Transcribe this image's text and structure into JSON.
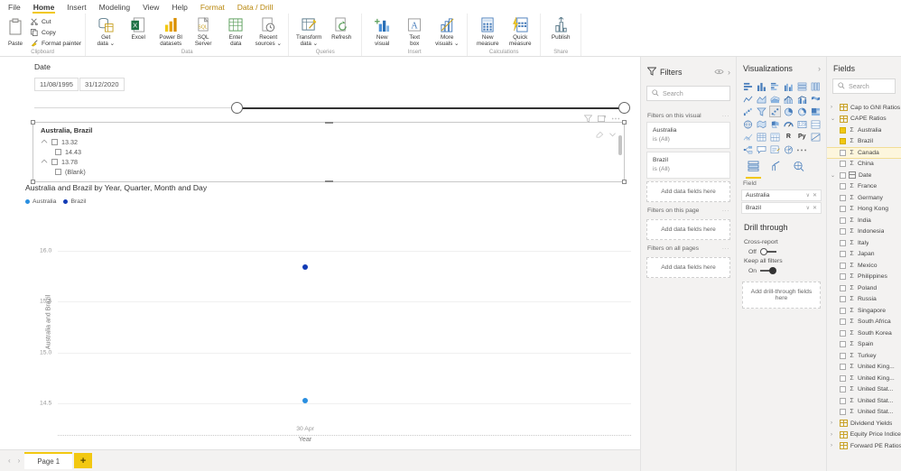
{
  "ribbon": {
    "tabs": [
      {
        "label": "File",
        "state": "normal"
      },
      {
        "label": "Home",
        "state": "active"
      },
      {
        "label": "Insert",
        "state": "normal"
      },
      {
        "label": "Modeling",
        "state": "normal"
      },
      {
        "label": "View",
        "state": "normal"
      },
      {
        "label": "Help",
        "state": "normal"
      },
      {
        "label": "Format",
        "state": "contextual"
      },
      {
        "label": "Data / Drill",
        "state": "contextual"
      }
    ],
    "groups": [
      {
        "name": "Clipboard",
        "paste": "Paste",
        "small": [
          {
            "label": "Cut",
            "icon": "scissors-icon"
          },
          {
            "label": "Copy",
            "icon": "copy-icon"
          },
          {
            "label": "Format painter",
            "icon": "paintbrush-icon"
          }
        ]
      },
      {
        "name": "Data",
        "buttons": [
          {
            "label": "Get\ndata ⌄",
            "icon": "get-data-icon"
          },
          {
            "label": "Excel",
            "icon": "excel-icon"
          },
          {
            "label": "Power BI\ndatasets",
            "icon": "powerbi-datasets-icon"
          },
          {
            "label": "SQL\nServer",
            "icon": "sql-server-icon"
          },
          {
            "label": "Enter\ndata",
            "icon": "enter-data-icon"
          },
          {
            "label": "Recent\nsources ⌄",
            "icon": "recent-sources-icon"
          }
        ]
      },
      {
        "name": "Queries",
        "buttons": [
          {
            "label": "Transform\ndata ⌄",
            "icon": "transform-data-icon"
          },
          {
            "label": "Refresh",
            "icon": "refresh-icon"
          }
        ]
      },
      {
        "name": "Insert",
        "buttons": [
          {
            "label": "New\nvisual",
            "icon": "new-visual-icon"
          },
          {
            "label": "Text\nbox",
            "icon": "text-box-icon"
          },
          {
            "label": "More\nvisuals ⌄",
            "icon": "more-visuals-icon"
          }
        ]
      },
      {
        "name": "Calculations",
        "buttons": [
          {
            "label": "New\nmeasure",
            "icon": "new-measure-icon"
          },
          {
            "label": "Quick\nmeasure",
            "icon": "quick-measure-icon"
          }
        ]
      },
      {
        "name": "Share",
        "buttons": [
          {
            "label": "Publish",
            "icon": "publish-icon"
          }
        ]
      }
    ]
  },
  "canvas": {
    "date_slicer": {
      "title": "Date",
      "start_value": "11/08/1995",
      "end_value": "31/12/2020",
      "handle_left_pct": 34,
      "handle_right_pct": 99
    },
    "hierarchy_slicer": {
      "title": "Australia, Brazil",
      "rows": [
        {
          "label": "13.32",
          "level": 0,
          "expanded": true,
          "checked": false
        },
        {
          "label": "14.43",
          "level": 1,
          "expanded": false,
          "checked": false
        },
        {
          "label": "13.78",
          "level": 0,
          "expanded": true,
          "checked": false
        },
        {
          "label": "(Blank)",
          "level": 1,
          "expanded": false,
          "checked": false
        }
      ],
      "header_icons": [
        "filter-icon",
        "focus-mode-icon",
        "more-options-icon"
      ],
      "inner_icons": [
        "clear-selections-icon",
        "chevron-down-icon"
      ]
    }
  },
  "chart_data": {
    "type": "scatter",
    "title": "Australia and Brazil by Year, Quarter, Month and Day",
    "xlabel": "Year",
    "ylabel": "Australia and Brazil",
    "yticks": [
      "16.0",
      "15.5",
      "15.0",
      "14.5"
    ],
    "ylim": [
      14.3,
      16.2
    ],
    "xticks": [
      "30 Apr"
    ],
    "grid": true,
    "legend_position": "top-left",
    "series": [
      {
        "name": "Australia",
        "color": "#2a8fe0",
        "points": [
          {
            "x": "30 Apr",
            "y": 14.53
          }
        ]
      },
      {
        "name": "Brazil",
        "color": "#123bb5",
        "points": [
          {
            "x": "30 Apr",
            "y": 15.84
          }
        ]
      }
    ]
  },
  "page_bar": {
    "prev_label": "‹",
    "next_label": "›",
    "tabs": [
      "Page 1"
    ],
    "add_label": "+"
  },
  "filters_pane": {
    "title": "Filters",
    "icons": [
      "filter-icon",
      "hide-pane-icon",
      "collapse-pane-icon"
    ],
    "search_placeholder": "Search",
    "sections": [
      {
        "label": "Filters on this visual",
        "cards": [
          {
            "name": "Australia",
            "state": "is (All)"
          },
          {
            "name": "Brazil",
            "state": "is (All)"
          }
        ],
        "dropzone": "Add data fields here"
      },
      {
        "label": "Filters on this page",
        "cards": [],
        "dropzone": "Add data fields here"
      },
      {
        "label": "Filters on all pages",
        "cards": [],
        "dropzone": "Add data fields here"
      }
    ]
  },
  "visualizations_pane": {
    "title": "Visualizations",
    "collapse_icon": "chevron-right-icon",
    "icons": [
      "stacked-bar-chart-icon",
      "stacked-column-chart-icon",
      "clustered-bar-chart-icon",
      "clustered-column-chart-icon",
      "100-stacked-bar-icon",
      "100-stacked-column-icon",
      "line-chart-icon",
      "area-chart-icon",
      "stacked-area-chart-icon",
      "line-stacked-column-icon",
      "line-clustered-column-icon",
      "ribbon-chart-icon",
      "waterfall-chart-icon",
      "funnel-icon",
      "scatter-chart-icon",
      "pie-chart-icon",
      "donut-chart-icon",
      "treemap-icon",
      "map-icon",
      "filled-map-icon",
      "shape-map-icon",
      "gauge-icon",
      "card-icon",
      "multi-row-card-icon",
      "kpi-icon",
      "table-icon",
      "matrix-icon",
      "r-script-visual-icon",
      "python-visual-icon",
      "key-influencers-icon",
      "decomposition-tree-icon",
      "q-and-a-icon",
      "smart-narrative-icon",
      "paginated-report-icon",
      "more-visuals-ellipsis-icon"
    ],
    "tabs": [
      "fields-tab-icon",
      "format-tab-icon",
      "analytics-tab-icon"
    ],
    "field_section_label": "Field",
    "field_wells": [
      "Australia",
      "Brazil"
    ],
    "drill_through": {
      "title": "Drill through",
      "cross_report_label": "Cross-report",
      "cross_report_state": "Off",
      "keep_filters_label": "Keep all filters",
      "keep_filters_state": "On",
      "dropzone": "Add drill-through fields here"
    }
  },
  "fields_pane": {
    "title": "Fields",
    "search_placeholder": "Search",
    "items": [
      {
        "label": "Cap to GNI Ratios",
        "type": "table",
        "expanded": false,
        "indent": 0
      },
      {
        "label": "CAPE Ratios",
        "type": "table",
        "expanded": true,
        "indent": 0,
        "selected": true
      },
      {
        "label": "Australia",
        "type": "measure",
        "checked": true,
        "indent": 1
      },
      {
        "label": "Brazil",
        "type": "measure",
        "checked": true,
        "indent": 1
      },
      {
        "label": "Canada",
        "type": "measure",
        "checked": false,
        "indent": 1,
        "highlight": true
      },
      {
        "label": "China",
        "type": "measure",
        "checked": false,
        "indent": 1
      },
      {
        "label": "Date",
        "type": "date-hierarchy",
        "checked": false,
        "indent": 1,
        "expanded": true
      },
      {
        "label": "France",
        "type": "measure",
        "checked": false,
        "indent": 1
      },
      {
        "label": "Germany",
        "type": "measure",
        "checked": false,
        "indent": 1
      },
      {
        "label": "Hong Kong",
        "type": "measure",
        "checked": false,
        "indent": 1
      },
      {
        "label": "India",
        "type": "measure",
        "checked": false,
        "indent": 1
      },
      {
        "label": "Indonesia",
        "type": "measure",
        "checked": false,
        "indent": 1
      },
      {
        "label": "Italy",
        "type": "measure",
        "checked": false,
        "indent": 1
      },
      {
        "label": "Japan",
        "type": "measure",
        "checked": false,
        "indent": 1
      },
      {
        "label": "Mexico",
        "type": "measure",
        "checked": false,
        "indent": 1
      },
      {
        "label": "Philippines",
        "type": "measure",
        "checked": false,
        "indent": 1
      },
      {
        "label": "Poland",
        "type": "measure",
        "checked": false,
        "indent": 1
      },
      {
        "label": "Russia",
        "type": "measure",
        "checked": false,
        "indent": 1
      },
      {
        "label": "Singapore",
        "type": "measure",
        "checked": false,
        "indent": 1
      },
      {
        "label": "South Africa",
        "type": "measure",
        "checked": false,
        "indent": 1
      },
      {
        "label": "South Korea",
        "type": "measure",
        "checked": false,
        "indent": 1
      },
      {
        "label": "Spain",
        "type": "measure",
        "checked": false,
        "indent": 1
      },
      {
        "label": "Turkey",
        "type": "measure",
        "checked": false,
        "indent": 1
      },
      {
        "label": "United King...",
        "type": "measure",
        "checked": false,
        "indent": 1
      },
      {
        "label": "United King...",
        "type": "measure",
        "checked": false,
        "indent": 1
      },
      {
        "label": "United Stat...",
        "type": "measure",
        "checked": false,
        "indent": 1
      },
      {
        "label": "United Stat...",
        "type": "measure",
        "checked": false,
        "indent": 1
      },
      {
        "label": "United Stat...",
        "type": "measure",
        "checked": false,
        "indent": 1
      },
      {
        "label": "Dividend Yields",
        "type": "table",
        "expanded": false,
        "indent": 0
      },
      {
        "label": "Equity Price Indices",
        "type": "table",
        "expanded": false,
        "indent": 0
      },
      {
        "label": "Forward PE Ratios",
        "type": "table",
        "expanded": false,
        "indent": 0
      }
    ]
  },
  "colors": {
    "accent": "#f2c811",
    "series_australia": "#2a8fe0",
    "series_brazil": "#123bb5",
    "pane_bg": "#f3f2f1"
  }
}
